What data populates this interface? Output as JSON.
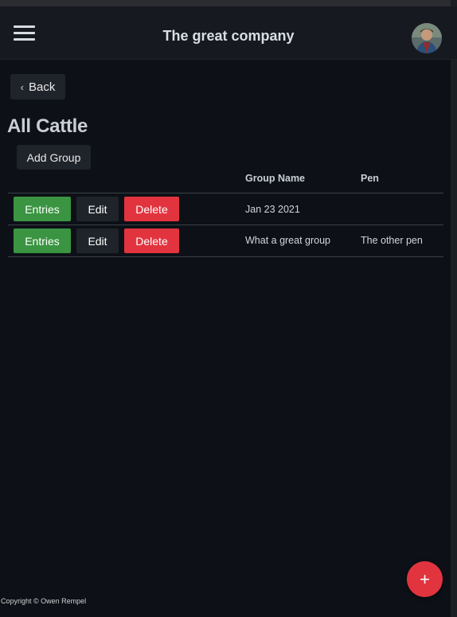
{
  "header": {
    "title": "The great company"
  },
  "nav": {
    "back_label": "Back"
  },
  "page": {
    "title": "All Cattle",
    "add_group_label": "Add Group"
  },
  "table": {
    "columns": [
      "Group Name",
      "Pen"
    ],
    "rows": [
      {
        "group_name": "Jan 23 2021",
        "pen": "",
        "entries": "Entries",
        "edit": "Edit",
        "delete": "Delete"
      },
      {
        "group_name": "What a great group",
        "pen": "The other pen",
        "entries": "Entries",
        "edit": "Edit",
        "delete": "Delete"
      }
    ]
  },
  "fab": {
    "label": "+"
  },
  "footer": {
    "copyright": "Copyright © Owen Rempel"
  },
  "colors": {
    "background": "#0d1117",
    "header": "#161a20",
    "entries": "#3a9441",
    "delete": "#e2343f",
    "neutral_button": "#1f232a"
  },
  "icons": {
    "menu": "menu-icon",
    "back": "chevron-left-icon",
    "avatar": "avatar",
    "fab": "plus-icon"
  }
}
